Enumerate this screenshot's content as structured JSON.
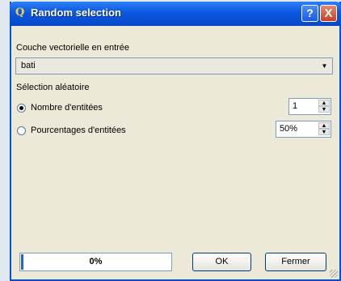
{
  "window": {
    "title": "Random selection",
    "app_icon": "qgis-icon",
    "help_label": "?",
    "close_label": "X"
  },
  "form": {
    "input_layer_label": "Couche vectorielle en entrée",
    "input_layer_value": "bati",
    "selection_label": "Sélection aléatoire",
    "options": [
      {
        "label": "Nombre d'entitées",
        "checked": true,
        "value": "1"
      },
      {
        "label": "Pourcentages d'entitées",
        "checked": false,
        "value": "50%"
      }
    ]
  },
  "footer": {
    "progress_text": "0%",
    "progress_value": 0,
    "ok_label": "OK",
    "close_label": "Fermer"
  }
}
